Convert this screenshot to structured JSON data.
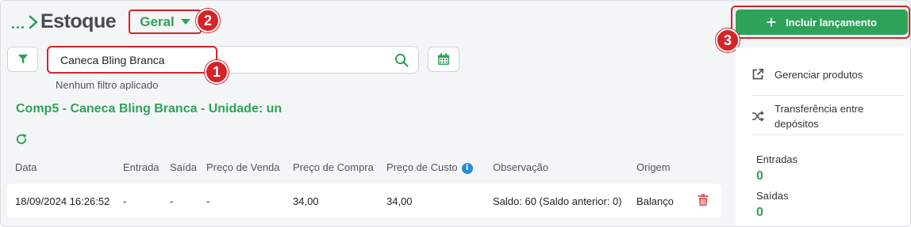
{
  "header": {
    "breadcrumb_dots": "...",
    "title": "Estoque",
    "view_selector": "Geral"
  },
  "search": {
    "value": "Caneca Bling Branca",
    "filter_note": "Nenhum filtro aplicado"
  },
  "product": {
    "title": "Comp5 - Caneca Bling Branca - Unidade: un"
  },
  "table": {
    "columns": [
      "Data",
      "Entrada",
      "Saída",
      "Preço de Venda",
      "Preço de Compra",
      "Preço de Custo",
      "Observação",
      "Origem"
    ],
    "rows": [
      {
        "data": "18/09/2024 16:26:52",
        "entrada": "-",
        "saida": "-",
        "preco_venda": "-",
        "preco_compra": "34,00",
        "preco_custo": "34,00",
        "observacao": "Saldo: 60 (Saldo anterior: 0)",
        "origem": "Balanço"
      }
    ]
  },
  "sidebar": {
    "add_button": "Incluir lançamento",
    "links": [
      {
        "label": "Gerenciar produtos",
        "icon": "external-link-icon"
      },
      {
        "label_line1": "Transferência entre",
        "label_line2": "depósitos",
        "icon": "shuffle-icon"
      }
    ],
    "stats": [
      {
        "label": "Entradas",
        "value": "0"
      },
      {
        "label": "Saídas",
        "value": "0"
      }
    ]
  },
  "annotations": [
    "1",
    "2",
    "3"
  ],
  "colors": {
    "brand_green": "#2fa25a",
    "highlight_red": "#d5232a",
    "info_blue": "#2a8ad8",
    "trash_red": "#e05a5a"
  }
}
